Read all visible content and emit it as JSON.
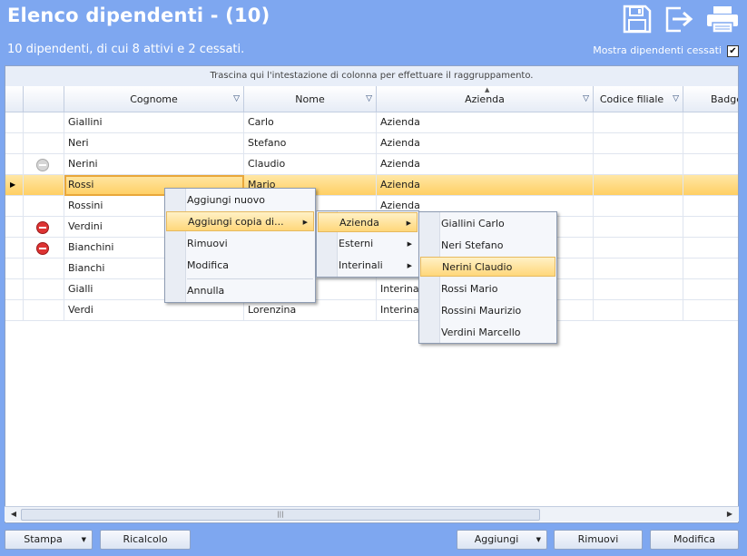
{
  "header": {
    "title": "Elenco dipendenti - (10)",
    "subtitle": "10 dipendenti, di cui 8 attivi e 2 cessati.",
    "show_terminated_label": "Mostra dipendenti cessati",
    "show_terminated_checked": "✔",
    "icons": [
      "save-icon",
      "export-icon",
      "print-icon"
    ]
  },
  "grid": {
    "group_hint": "Trascina qui l'intestazione di colonna per effettuare il raggruppamento.",
    "columns": [
      "Cognome",
      "Nome",
      "Azienda",
      "Codice filiale",
      "Badge"
    ],
    "rows": [
      {
        "status": "",
        "cognome": "Giallini",
        "nome": "Carlo",
        "azienda": "Azienda"
      },
      {
        "status": "",
        "cognome": "Neri",
        "nome": "Stefano",
        "azienda": "Azienda"
      },
      {
        "status": "off",
        "cognome": "Nerini",
        "nome": "Claudio",
        "azienda": "Azienda"
      },
      {
        "status": "",
        "cognome": "Rossi",
        "nome": "Mario",
        "azienda": "Azienda"
      },
      {
        "status": "",
        "cognome": "Rossini",
        "nome": "",
        "azienda": "Azienda"
      },
      {
        "status": "on",
        "cognome": "Verdini",
        "nome": "",
        "azienda": ""
      },
      {
        "status": "on",
        "cognome": "Bianchini",
        "nome": "",
        "azienda": ""
      },
      {
        "status": "",
        "cognome": "Bianchi",
        "nome": "",
        "azienda": ""
      },
      {
        "status": "",
        "cognome": "Gialli",
        "nome": "",
        "azienda": "Interinali"
      },
      {
        "status": "",
        "cognome": "Verdi",
        "nome": "Lorenzina",
        "azienda": "Interinali"
      }
    ],
    "selected_row_marker": "▶",
    "scrollbar_grip": "|||"
  },
  "context_menu": {
    "items": [
      "Aggiungi nuovo",
      "Aggiungi copia di...",
      "Rimuovi",
      "Modifica",
      "Annulla"
    ],
    "submenu": [
      "Azienda",
      "Esterni",
      "Interinali"
    ],
    "employees": [
      "Giallini Carlo",
      "Neri Stefano",
      "Nerini Claudio",
      "Rossi Mario",
      "Rossini Maurizio",
      "Verdini Marcello"
    ]
  },
  "buttons": {
    "stampa": "Stampa",
    "ricalcolo": "Ricalcolo",
    "aggiungi": "Aggiungi",
    "rimuovi": "Rimuovi",
    "modifica": "Modifica"
  },
  "colors": {
    "background": "#7ea7f0",
    "selection": "#ffcf63",
    "terminated_badge": "#d33333"
  }
}
